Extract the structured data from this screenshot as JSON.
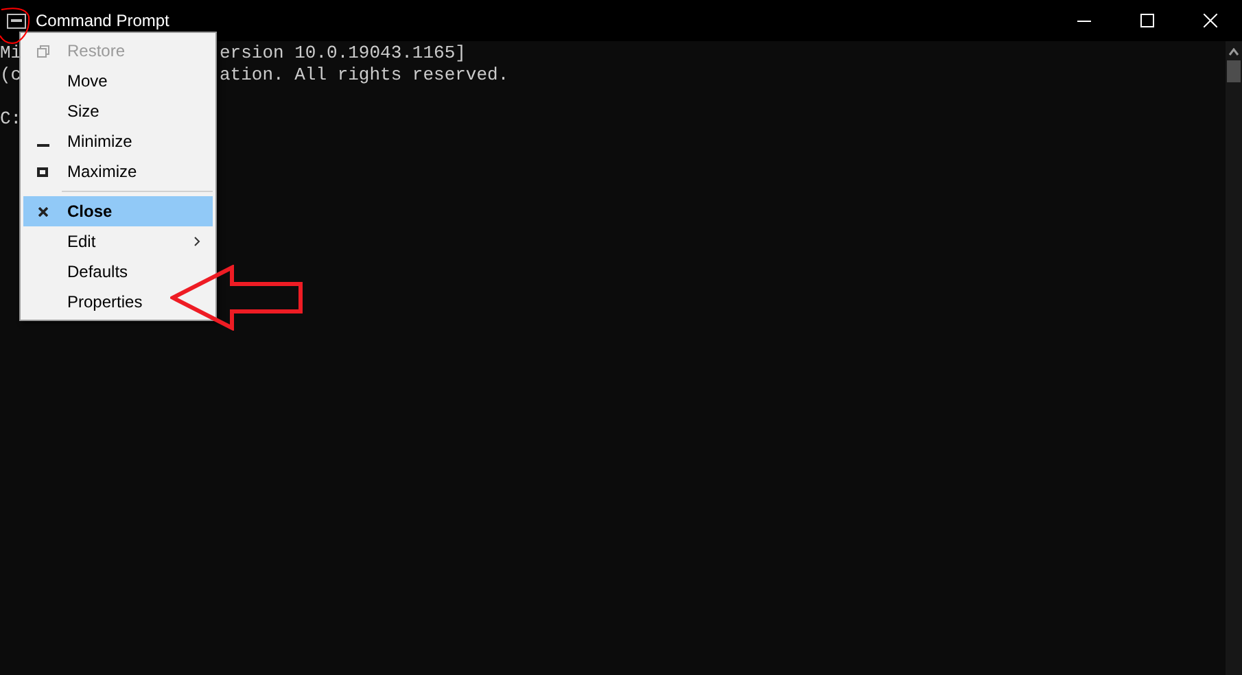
{
  "window": {
    "title": "Command Prompt"
  },
  "console": {
    "lines": [
      {
        "left": "Mi",
        "right": "ersion 10.0.19043.1165]"
      },
      {
        "left": "(c",
        "right": "ation. All rights reserved."
      }
    ],
    "prompt": "C:"
  },
  "menu": {
    "items": [
      {
        "label": "Restore",
        "kind": "restore",
        "disabled": true,
        "selected": false
      },
      {
        "label": "Move",
        "kind": "plain",
        "disabled": false,
        "selected": false
      },
      {
        "label": "Size",
        "kind": "plain",
        "disabled": false,
        "selected": false
      },
      {
        "label": "Minimize",
        "kind": "minimize",
        "disabled": false,
        "selected": false
      },
      {
        "label": "Maximize",
        "kind": "maximize",
        "disabled": false,
        "selected": false
      },
      {
        "kind": "separator"
      },
      {
        "label": "Close",
        "kind": "close",
        "disabled": false,
        "selected": true
      },
      {
        "label": "Edit",
        "kind": "submenu",
        "disabled": false,
        "selected": false
      },
      {
        "label": "Defaults",
        "kind": "plain",
        "disabled": false,
        "selected": false
      },
      {
        "label": "Properties",
        "kind": "plain",
        "disabled": false,
        "selected": false
      }
    ]
  }
}
